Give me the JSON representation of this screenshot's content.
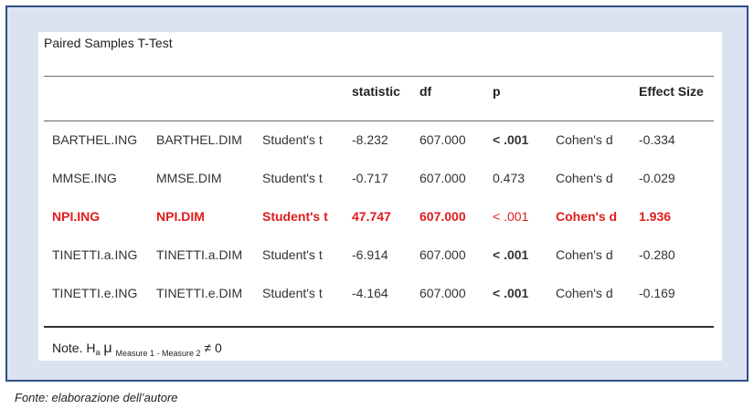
{
  "table_title": "Paired Samples T-Test",
  "headers": {
    "statistic": "statistic",
    "df": "df",
    "p": "p",
    "effect_size": "Effect Size"
  },
  "rows": [
    {
      "m1": "BARTHEL.ING",
      "m2": "BARTHEL.DIM",
      "test": "Student's t",
      "statistic": "-8.232",
      "df": "607.000",
      "p": "< .001",
      "measure": "Cohen's d",
      "effect": "-0.334"
    },
    {
      "m1": "MMSE.ING",
      "m2": "MMSE.DIM",
      "test": "Student's t",
      "statistic": "-0.717",
      "df": "607.000",
      "p": "0.473",
      "measure": "Cohen's d",
      "effect": "-0.029"
    },
    {
      "m1": "NPI.ING",
      "m2": "NPI.DIM",
      "test": "Student's t",
      "statistic": "47.747",
      "df": "607.000",
      "p": "< .001",
      "measure": "Cohen's d",
      "effect": "1.936"
    },
    {
      "m1": "TINETTI.a.ING",
      "m2": "TINETTI.a.DIM",
      "test": "Student's t",
      "statistic": "-6.914",
      "df": "607.000",
      "p": "< .001",
      "measure": "Cohen's d",
      "effect": "-0.280"
    },
    {
      "m1": "TINETTI.e.ING",
      "m2": "TINETTI.e.DIM",
      "test": "Student's t",
      "statistic": "-4.164",
      "df": "607.000",
      "p": "< .001",
      "measure": "Cohen's d",
      "effect": "-0.169"
    }
  ],
  "highlight_color": "#e01b1b",
  "note": {
    "prefix": "Note. H",
    "sub_a": "a",
    "mu": "μ",
    "sub_measure": "Measure 1 - Measure 2",
    "suffix": "≠ 0"
  },
  "caption": "Fonte: elaborazione dell’autore"
}
